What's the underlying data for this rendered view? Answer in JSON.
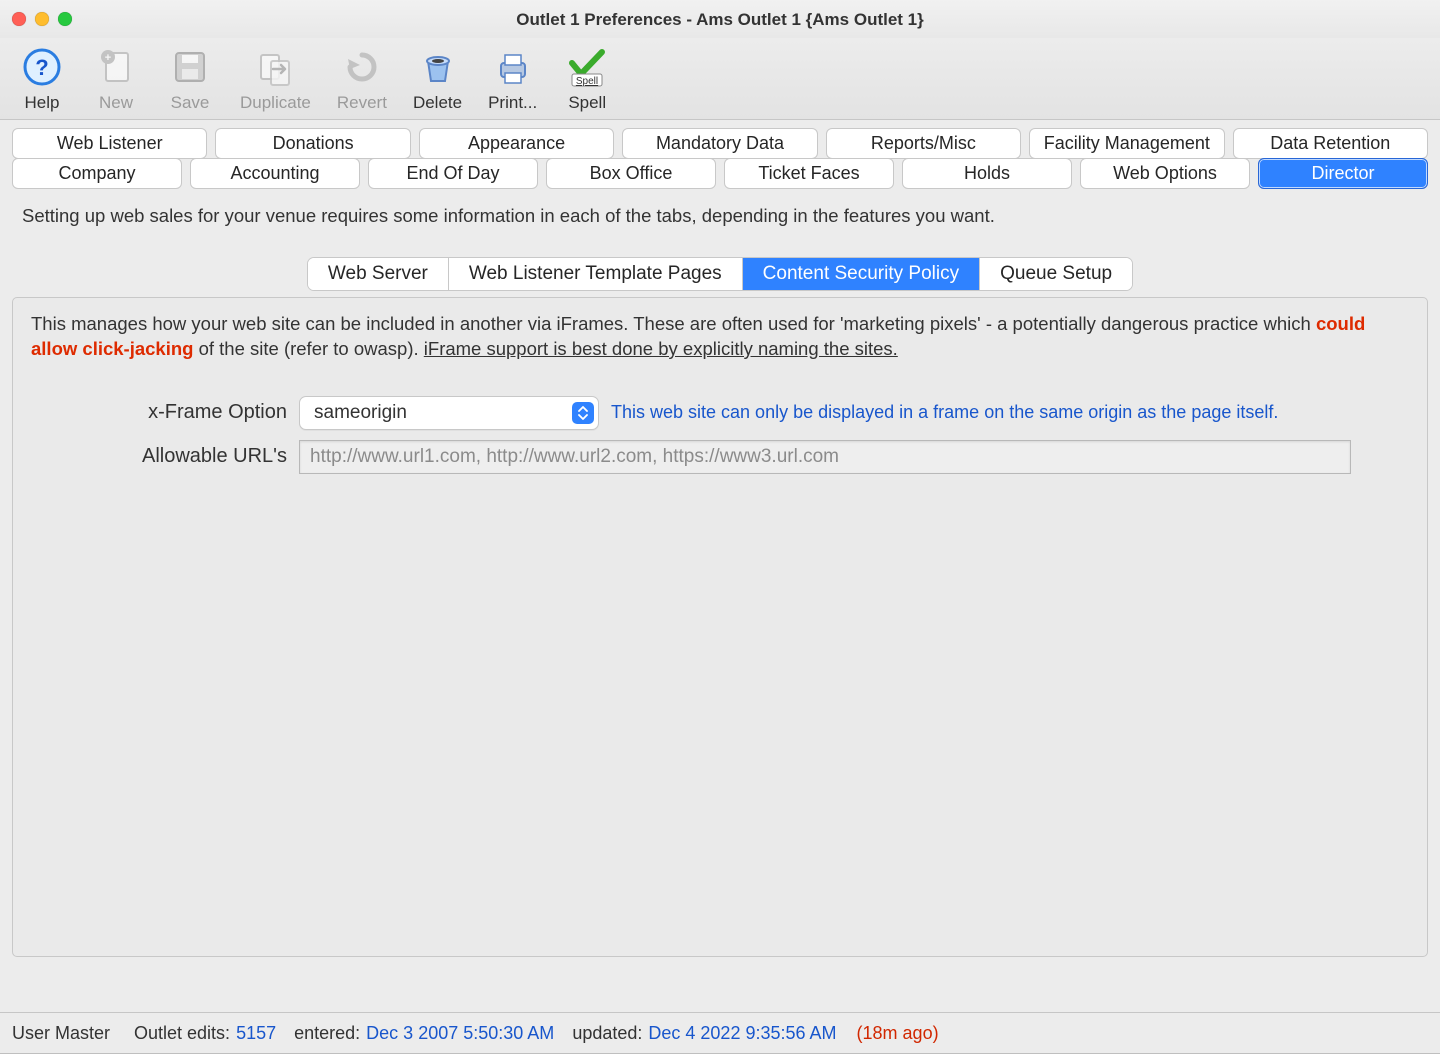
{
  "window": {
    "title": "Outlet 1 Preferences - Ams Outlet 1 {Ams Outlet 1}"
  },
  "toolbar": {
    "help": {
      "label": "Help",
      "icon": "help-icon"
    },
    "new": {
      "label": "New",
      "icon": "new-icon"
    },
    "save": {
      "label": "Save",
      "icon": "save-icon"
    },
    "duplicate": {
      "label": "Duplicate",
      "icon": "duplicate-icon"
    },
    "revert": {
      "label": "Revert",
      "icon": "revert-icon"
    },
    "delete": {
      "label": "Delete",
      "icon": "delete-icon"
    },
    "print": {
      "label": "Print...",
      "icon": "print-icon"
    },
    "spell": {
      "label": "Spell",
      "icon": "spell-icon"
    }
  },
  "tabs_row1": [
    "Web Listener",
    "Donations",
    "Appearance",
    "Mandatory Data",
    "Reports/Misc",
    "Facility Management",
    "Data Retention"
  ],
  "tabs_row2": [
    "Company",
    "Accounting",
    "End Of Day",
    "Box Office",
    "Ticket Faces",
    "Holds",
    "Web Options",
    "Director"
  ],
  "selected_tab_row2": "Director",
  "infoline": "Setting up web sales for your venue requires some information in each of the tabs, depending in the features you want.",
  "subtabs": [
    "Web Server",
    "Web Listener Template Pages",
    "Content Security Policy",
    "Queue Setup"
  ],
  "selected_subtab": "Content Security Policy",
  "csp": {
    "desc_part1": "This manages how your web site can be included in another via iFrames.  These are often used for 'marketing pixels' - a potentially dangerous practice which ",
    "desc_red": "could allow click-jacking",
    "desc_part2": " of the site (refer to owasp).   ",
    "desc_underlined": "iFrame support is best done by explicitly naming the sites.",
    "xframe_label": "x-Frame Option",
    "xframe_value": "sameorigin",
    "xframe_hint": "This web site can only be displayed in a frame on the same origin as the page itself.",
    "urls_label": "Allowable URL's",
    "urls_placeholder": "http://www.url1.com, http://www.url2.com, https://www3.url.com",
    "urls_value": ""
  },
  "status": {
    "user_label": "User Master",
    "edits_label": "Outlet edits:",
    "edits_value": "5157",
    "entered_label": "entered:",
    "entered_value": "Dec 3 2007 5:50:30 AM",
    "updated_label": "updated:",
    "updated_value": "Dec 4 2022 9:35:56 AM",
    "age": "(18m ago)"
  }
}
